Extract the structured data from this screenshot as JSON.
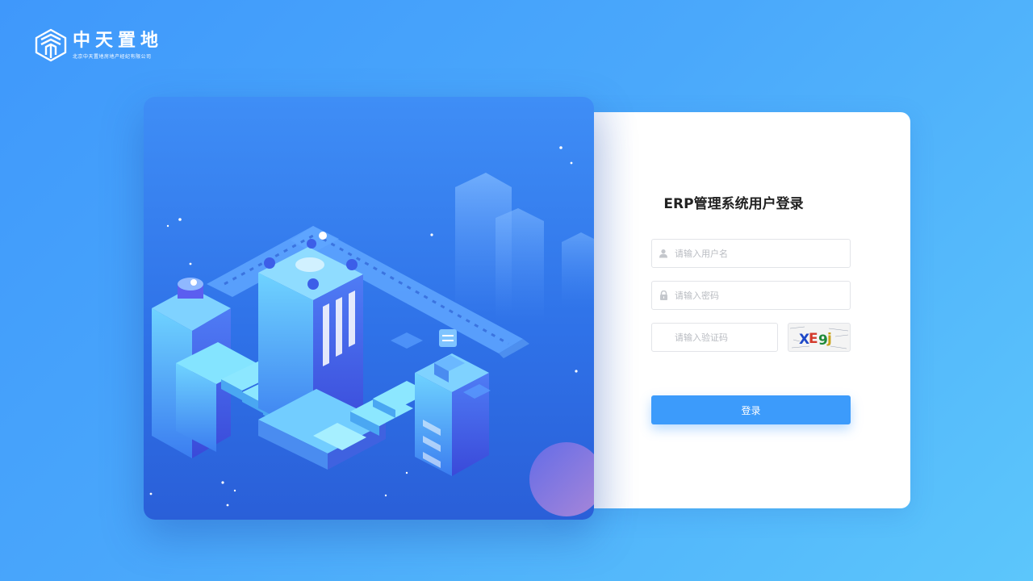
{
  "brand": {
    "name": "中天置地",
    "subtitle": "北京中天置地房地产经纪有限公司"
  },
  "login": {
    "title": "ERP管理系统用户登录",
    "username_placeholder": "请输入用户名",
    "password_placeholder": "请输入密码",
    "captcha_placeholder": "请输入验证码",
    "captcha_text": "XE9j",
    "submit_label": "登录"
  },
  "colors": {
    "background_start": "#3f98fb",
    "background_end": "#5cc6fb",
    "button": "#3c9bfb",
    "title": "#222222"
  }
}
